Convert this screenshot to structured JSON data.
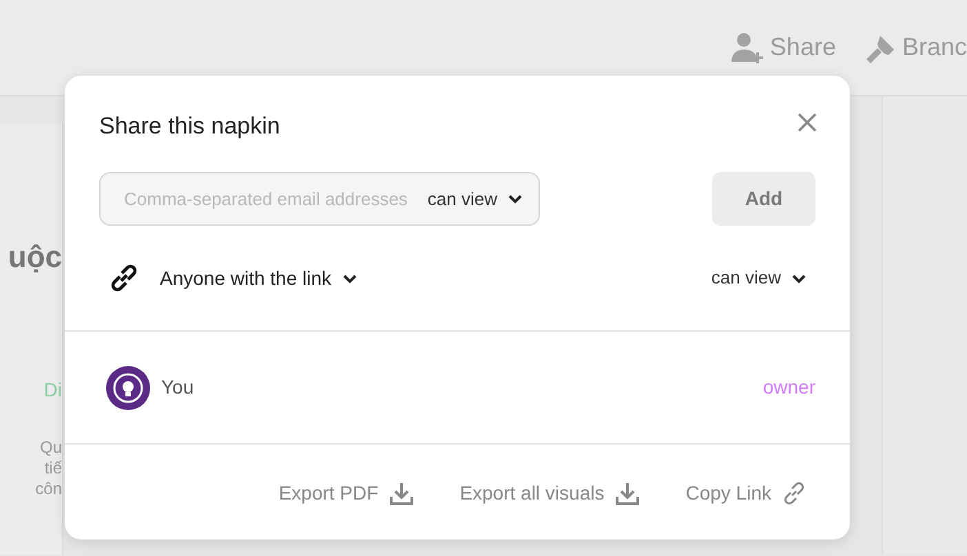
{
  "toolbar": {
    "buttons": [
      {
        "label": "Share",
        "kind": "share"
      },
      {
        "label": "Branc",
        "kind": "brand"
      }
    ]
  },
  "background": {
    "heading": "uộc",
    "tag": "Di",
    "lines": [
      "Qu",
      "tiế",
      "côn"
    ]
  },
  "dialog": {
    "title": "Share this napkin",
    "email": {
      "placeholder": "Comma-separated email addresses",
      "permission": "can view"
    },
    "add_button": {
      "label": "Add",
      "disabled": true
    },
    "link_access": {
      "label": "Anyone with the link",
      "permission": "can view"
    },
    "members": [
      {
        "name": "You",
        "role": "owner"
      }
    ],
    "footer_actions": [
      {
        "label": "Export PDF",
        "kind": "download"
      },
      {
        "label": "Export all visuals",
        "kind": "download"
      },
      {
        "label": "Copy Link",
        "kind": "link"
      }
    ]
  }
}
